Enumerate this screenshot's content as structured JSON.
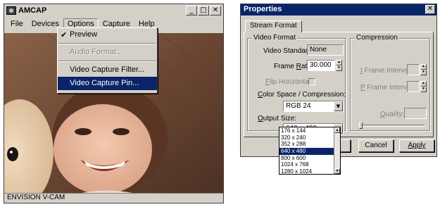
{
  "amcap": {
    "title": "AMCAP",
    "win_buttons": {
      "minimize": "_",
      "maximize": "□",
      "close": "✕"
    },
    "menu": [
      "File",
      "Devices",
      "Options",
      "Capture",
      "Help"
    ],
    "options_menu": {
      "items": [
        {
          "label": "Preview",
          "checked": true,
          "disabled": false,
          "selected": false
        },
        {
          "label": "Audio Format...",
          "checked": false,
          "disabled": true,
          "selected": false
        },
        {
          "label": "Video Capture Filter...",
          "checked": false,
          "disabled": false,
          "selected": false
        },
        {
          "label": "Video Capture Pin...",
          "checked": false,
          "disabled": false,
          "selected": true
        }
      ]
    },
    "status": "ENVISION V-CAM"
  },
  "props": {
    "title": "Properties",
    "close": "✕",
    "tab": "Stream Format",
    "video_format": {
      "group": "Video Format",
      "standard_label": "Video Standard:",
      "standard_value": "None",
      "frame_rate_label": "Frame Rate:",
      "frame_rate_value": "30.000",
      "flip_label": "Flip Horizontal:",
      "color_label": "Color Space / Compression:",
      "color_value": "RGB 24",
      "output_label": "Output Size:",
      "output_value": "640 x 480"
    },
    "compression": {
      "group": "Compression",
      "iframe_label": "I Frame Interval:",
      "pframe_label": "P Frame Interval:",
      "quality_label": "Quality:"
    },
    "buttons": {
      "cancel": "Cancel",
      "apply": "Apply"
    },
    "output_sizes": [
      "176 x 144",
      "320 x 240",
      "352 x 288",
      "640 x 480",
      "800 x 600",
      "1024 x 768",
      "1280 x 1024"
    ],
    "output_selected": "640 x 480"
  }
}
